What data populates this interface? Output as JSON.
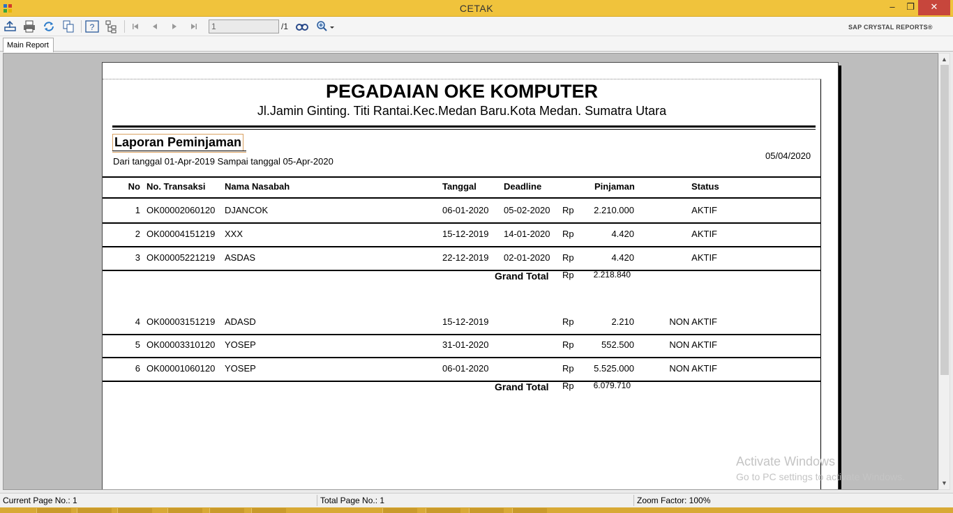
{
  "window": {
    "title": "CETAK",
    "min_label": "–",
    "max_label": "❐",
    "close_label": "✕"
  },
  "toolbar": {
    "page_input_value": "1",
    "page_total": "/1",
    "brand": "SAP CRYSTAL REPORTS®",
    "icons": [
      "export-icon",
      "print-icon",
      "refresh-icon",
      "copy-icon",
      "help-icon",
      "group-tree-icon",
      "first-page-icon",
      "prev-page-icon",
      "next-page-icon",
      "last-page-icon",
      "find-icon",
      "zoom-icon"
    ]
  },
  "tabs": {
    "main": "Main Report"
  },
  "report": {
    "company": "PEGADAIAN OKE KOMPUTER",
    "address": "Jl.Jamin Ginting. Titi Rantai.Kec.Medan Baru.Kota Medan. Sumatra Utara",
    "heading": "Laporan Peminjaman",
    "range": "Dari tanggal 01-Apr-2019 Sampai tanggal 05-Apr-2020",
    "print_date": "05/04/2020",
    "columns": {
      "no": "No",
      "trx": "No. Transaksi",
      "nama": "Nama Nasabah",
      "tanggal": "Tanggal",
      "deadline": "Deadline",
      "pinjaman": "Pinjaman",
      "status": "Status"
    },
    "group1": [
      {
        "no": "1",
        "trx": "OK00002060120",
        "nama": "DJANCOK",
        "tanggal": "06-01-2020",
        "deadline": "05-02-2020",
        "rp": "Rp",
        "pinjaman": "2.210.000",
        "status": "AKTIF"
      },
      {
        "no": "2",
        "trx": "OK00004151219",
        "nama": "XXX",
        "tanggal": "15-12-2019",
        "deadline": "14-01-2020",
        "rp": "Rp",
        "pinjaman": "4.420",
        "status": "AKTIF"
      },
      {
        "no": "3",
        "trx": "OK00005221219",
        "nama": "ASDAS",
        "tanggal": "22-12-2019",
        "deadline": "02-01-2020",
        "rp": "Rp",
        "pinjaman": "4.420",
        "status": "AKTIF"
      }
    ],
    "group1_total": {
      "label": "Grand Total",
      "rp": "Rp",
      "value": "2.218.840"
    },
    "group2": [
      {
        "no": "4",
        "trx": "OK00003151219",
        "nama": "ADASD",
        "tanggal": "15-12-2019",
        "deadline": "",
        "rp": "Rp",
        "pinjaman": "2.210",
        "status": "NON AKTIF"
      },
      {
        "no": "5",
        "trx": "OK00003310120",
        "nama": "YOSEP",
        "tanggal": "31-01-2020",
        "deadline": "",
        "rp": "Rp",
        "pinjaman": "552.500",
        "status": "NON AKTIF"
      },
      {
        "no": "6",
        "trx": "OK00001060120",
        "nama": "YOSEP",
        "tanggal": "06-01-2020",
        "deadline": "",
        "rp": "Rp",
        "pinjaman": "5.525.000",
        "status": "NON AKTIF"
      }
    ],
    "group2_total": {
      "label": "Grand Total",
      "rp": "Rp",
      "value": "6.079.710"
    }
  },
  "watermark": {
    "line1": "Activate Windows",
    "line2": "Go to PC settings to activate Windows."
  },
  "statusbar": {
    "current_page": "Current Page No.: 1",
    "total_page": "Total Page No.: 1",
    "zoom": "Zoom Factor: 100%"
  }
}
